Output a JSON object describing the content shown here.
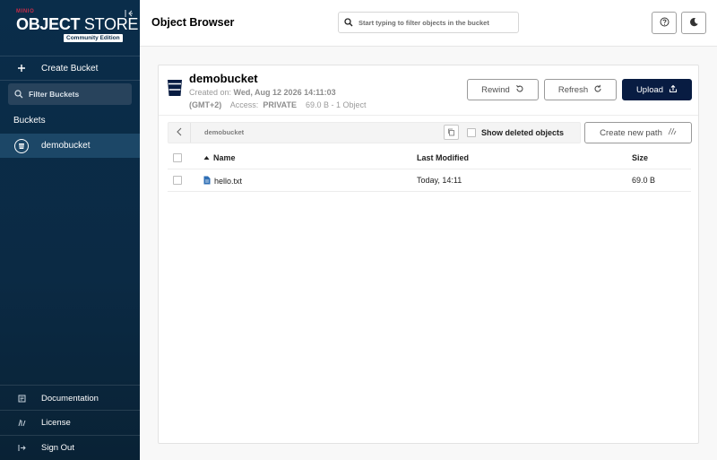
{
  "sidebar": {
    "logo_small": "MINIO",
    "logo_bold": "OBJECT",
    "logo_light": " STORE",
    "edition": "Community Edition",
    "create_bucket": "Create Bucket",
    "filter_buckets": "Filter Buckets",
    "buckets_heading": "Buckets",
    "buckets": [
      {
        "name": "demobucket"
      }
    ],
    "bottom": [
      {
        "label": "Documentation",
        "icon": "documentation-icon"
      },
      {
        "label": "License",
        "icon": "license-icon"
      },
      {
        "label": "Sign Out",
        "icon": "sign-out-icon"
      }
    ]
  },
  "header": {
    "title": "Object Browser",
    "search_placeholder": "Start typing to filter objects in the bucket",
    "help_icon": "help-icon",
    "theme_icon": "dark-mode-icon"
  },
  "bucket": {
    "name": "demobucket",
    "created_label": "Created on:",
    "created_value": "Wed, Aug 12 2026 14:11:03",
    "timezone": "(GMT+2)",
    "access_label": "Access:",
    "access_value": "PRIVATE",
    "size_summary": "69.0 B - 1 Object"
  },
  "actions": {
    "rewind": "Rewind",
    "refresh": "Refresh",
    "upload": "Upload"
  },
  "pathbar": {
    "path": "demobucket",
    "show_deleted": "Show deleted objects",
    "create_path": "Create new path"
  },
  "table": {
    "columns": [
      "Name",
      "Last Modified",
      "Size"
    ],
    "rows": [
      {
        "name": "hello.txt",
        "modified": "Today, 14:11",
        "size": "69.0 B"
      }
    ]
  },
  "colors": {
    "sidebar_bg": "#0a2d4a",
    "selected_bucket_bg": "#1c4767",
    "primary_button": "#081c42",
    "logo_accent": "#c72c48"
  }
}
